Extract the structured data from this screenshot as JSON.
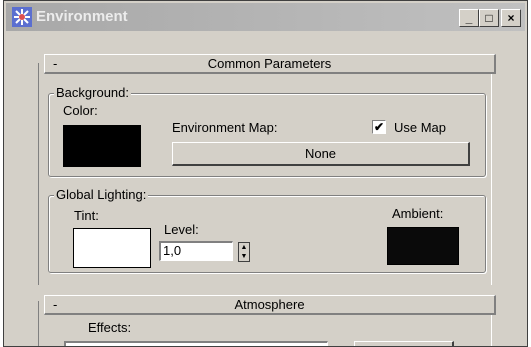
{
  "window": {
    "title": "Environment",
    "icon": "max-snowflake-icon",
    "minimize_glyph": "_",
    "maximize_glyph": "□",
    "close_glyph": "×"
  },
  "common_parameters": {
    "collapse_glyph": "-",
    "title": "Common Parameters",
    "background": {
      "group_label": "Background:",
      "color_label": "Color:",
      "color_value": "#000000",
      "environment_map_label": "Environment Map:",
      "use_map_label": "Use Map",
      "use_map_checked": true,
      "map_button_label": "None"
    },
    "global_lighting": {
      "group_label": "Global Lighting:",
      "tint_label": "Tint:",
      "tint_color": "#ffffff",
      "level_label": "Level:",
      "level_value": "1,0",
      "ambient_label": "Ambient:",
      "ambient_color": "#0a0a0a"
    }
  },
  "atmosphere": {
    "collapse_glyph": "-",
    "title": "Atmosphere",
    "effects_label": "Effects:"
  }
}
